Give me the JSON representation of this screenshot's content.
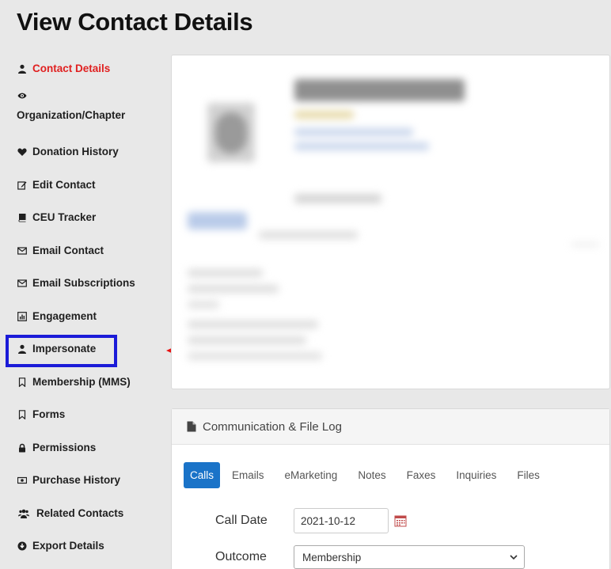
{
  "page": {
    "title": "View Contact Details"
  },
  "sidebar": {
    "items": [
      {
        "label": "Contact Details",
        "icon": "user-icon",
        "active": true
      },
      {
        "label": "Organization/Chapter",
        "icon": "eye-icon"
      },
      {
        "label": "Donation History",
        "icon": "heart-icon"
      },
      {
        "label": "Edit Contact",
        "icon": "edit-icon"
      },
      {
        "label": "CEU Tracker",
        "icon": "book-icon"
      },
      {
        "label": "Email Contact",
        "icon": "envelope-icon"
      },
      {
        "label": "Email Subscriptions",
        "icon": "envelope-icon"
      },
      {
        "label": "Engagement",
        "icon": "bar-chart-icon"
      },
      {
        "label": "Impersonate",
        "icon": "user-icon"
      },
      {
        "label": "Membership (MMS)",
        "icon": "bookmark-icon"
      },
      {
        "label": "Forms",
        "icon": "bookmark-icon"
      },
      {
        "label": "Permissions",
        "icon": "lock-icon"
      },
      {
        "label": "Purchase History",
        "icon": "money-icon"
      },
      {
        "label": "Related Contacts",
        "icon": "users-icon"
      },
      {
        "label": "Export Details",
        "icon": "download-circle-icon"
      }
    ]
  },
  "annotation": {
    "highlight_color": "#1b1bd8",
    "arrow_color": "#e81010"
  },
  "log": {
    "title": "Communication & File Log",
    "tabs": [
      "Calls",
      "Emails",
      "eMarketing",
      "Notes",
      "Faxes",
      "Inquiries",
      "Files"
    ],
    "active_tab": "Calls",
    "call_date_label": "Call Date",
    "call_date_value": "2021-10-12",
    "outcome_label": "Outcome",
    "outcome_value": "Membership"
  },
  "colors": {
    "accent": "#1a73c8",
    "active_sidebar": "#e02020"
  }
}
